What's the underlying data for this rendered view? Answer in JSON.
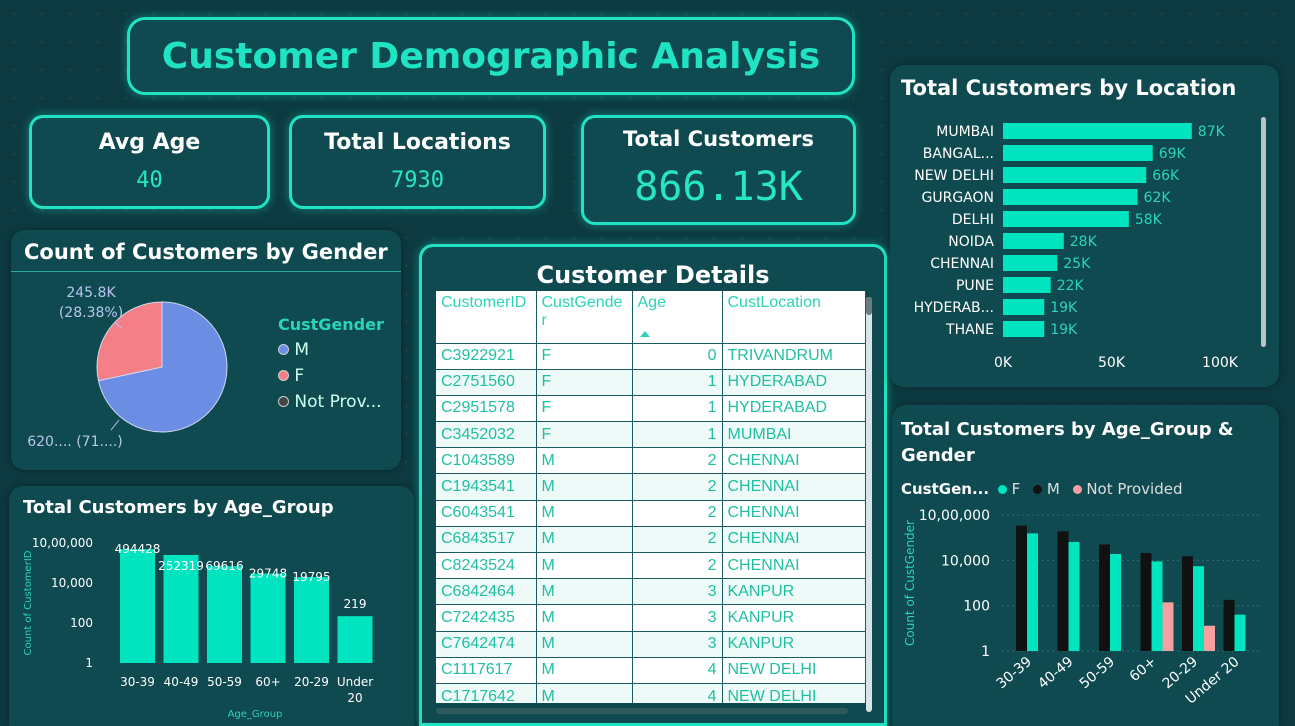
{
  "header": {
    "title": "Customer Demographic Analysis"
  },
  "kpis": {
    "avg_age": {
      "label": "Avg Age",
      "value": "40"
    },
    "total_locations": {
      "label": "Total Locations",
      "value": "7930"
    },
    "total_customers": {
      "label": "Total Customers",
      "value": "866.13K"
    }
  },
  "gender_chart": {
    "title": "Count of Customers by Gender",
    "legend_title": "CustGender",
    "legend": [
      "M",
      "F",
      "Not Prov..."
    ],
    "labels": {
      "f_value": "245.8K",
      "f_pct": "(28.38%)",
      "m_label": "620.... (71....)"
    }
  },
  "details": {
    "title": "Customer Details",
    "columns": [
      "CustomerID",
      "CustGende r",
      "Age",
      "CustLocation"
    ],
    "rows": [
      [
        "C3922921",
        "F",
        "0",
        "TRIVANDRUM"
      ],
      [
        "C2751560",
        "F",
        "1",
        "HYDERABAD"
      ],
      [
        "C2951578",
        "F",
        "1",
        "HYDERABAD"
      ],
      [
        "C3452032",
        "F",
        "1",
        "MUMBAI"
      ],
      [
        "C1043589",
        "M",
        "2",
        "CHENNAI"
      ],
      [
        "C1943541",
        "M",
        "2",
        "CHENNAI"
      ],
      [
        "C6043541",
        "M",
        "2",
        "CHENNAI"
      ],
      [
        "C6843517",
        "M",
        "2",
        "CHENNAI"
      ],
      [
        "C8243524",
        "M",
        "2",
        "CHENNAI"
      ],
      [
        "C6842464",
        "M",
        "3",
        "KANPUR"
      ],
      [
        "C7242435",
        "M",
        "3",
        "KANPUR"
      ],
      [
        "C7642474",
        "M",
        "3",
        "KANPUR"
      ],
      [
        "C1117617",
        "M",
        "4",
        "NEW DELHI"
      ],
      [
        "C1717642",
        "M",
        "4",
        "NEW DELHI"
      ]
    ]
  },
  "colors": {
    "accent": "#1fe3c2",
    "teal_bar": "#00e5c0",
    "male": "#6b8de3",
    "female": "#f47f86",
    "np": "#f4a0a0",
    "black": "#111111"
  },
  "chart_data": [
    {
      "type": "pie",
      "title": "Count of Customers by Gender",
      "categories": [
        "M",
        "F",
        "Not Provided"
      ],
      "values": [
        620.3,
        245.8,
        0.03
      ],
      "percent_labels": [
        "(71....)",
        "(28.38%)",
        ""
      ]
    },
    {
      "type": "bar",
      "orientation": "horizontal",
      "title": "Total Customers by Location",
      "categories": [
        "MUMBAI",
        "BANGAL...",
        "NEW DELHI",
        "GURGAON",
        "DELHI",
        "NOIDA",
        "CHENNAI",
        "PUNE",
        "HYDERAB...",
        "THANE"
      ],
      "values": [
        87,
        69,
        66,
        62,
        58,
        28,
        25,
        22,
        19,
        19
      ],
      "value_labels": [
        "87K",
        "69K",
        "66K",
        "62K",
        "58K",
        "28K",
        "25K",
        "22K",
        "19K",
        "19K"
      ],
      "x_ticks": [
        "0K",
        "50K",
        "100K"
      ],
      "xlim": [
        0,
        100
      ]
    },
    {
      "type": "bar",
      "title": "Total Customers by Age_Group",
      "categories": [
        "30-39",
        "40-49",
        "50-59",
        "60+",
        "20-29",
        "Under 20"
      ],
      "values": [
        494428,
        252319,
        69616,
        29748,
        19795,
        219
      ],
      "xlabel": "Age_Group",
      "ylabel": "Count of CustomerID",
      "y_ticks": [
        "1",
        "100",
        "10,000",
        "10,00,000"
      ],
      "y_scale": "log"
    },
    {
      "type": "bar",
      "title": "Total Customers by Age_Group & Gender",
      "legend_title": "CustGen...",
      "categories": [
        "30-39",
        "40-49",
        "50-59",
        "60+",
        "20-29",
        "Under 20"
      ],
      "series": [
        {
          "name": "F",
          "values": [
            155000,
            65000,
            19000,
            9000,
            5500,
            40
          ]
        },
        {
          "name": "M",
          "values": [
            340000,
            190000,
            50000,
            21000,
            15000,
            180
          ]
        },
        {
          "name": "Not Provided",
          "values": [
            0,
            0,
            0,
            140,
            0,
            0
          ]
        }
      ],
      "extra_np_bars": {
        "20-29": 13
      },
      "ylabel": "Count of CustGender",
      "y_ticks": [
        "1",
        "100",
        "10,000",
        "10,00,000"
      ],
      "y_scale": "log"
    }
  ]
}
